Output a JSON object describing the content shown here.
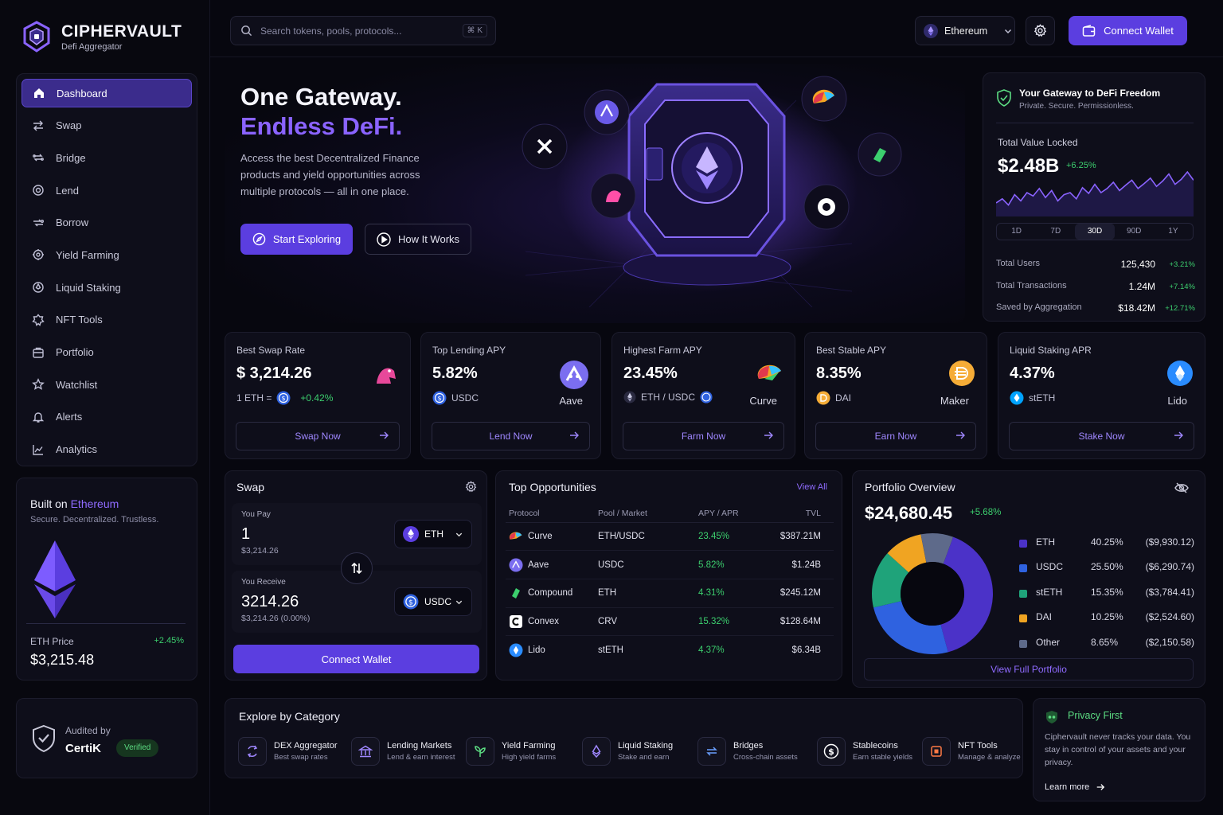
{
  "brand": {
    "name": "CIPHERVAULT",
    "subtitle": "Defi Aggregator"
  },
  "nav": [
    {
      "label": "Dashboard",
      "icon": "home-icon",
      "active": true
    },
    {
      "label": "Swap",
      "icon": "swap-icon"
    },
    {
      "label": "Bridge",
      "icon": "bridge-icon"
    },
    {
      "label": "Lend",
      "icon": "lend-icon"
    },
    {
      "label": "Borrow",
      "icon": "borrow-icon"
    },
    {
      "label": "Yield Farming",
      "icon": "yield-icon"
    },
    {
      "label": "Liquid Staking",
      "icon": "staking-icon"
    },
    {
      "label": "NFT Tools",
      "icon": "nft-icon"
    },
    {
      "label": "Portfolio",
      "icon": "portfolio-icon"
    },
    {
      "label": "Watchlist",
      "icon": "star-icon"
    },
    {
      "label": "Alerts",
      "icon": "bell-icon"
    },
    {
      "label": "Analytics",
      "icon": "chart-icon"
    }
  ],
  "built": {
    "prefix": "Built on ",
    "chain": "Ethereum",
    "tagline": "Secure. Decentralized. Trustless.",
    "price_label": "ETH Price",
    "price_change": "+2.45%",
    "price_value": "$3,215.48"
  },
  "audit": {
    "label": "Audited by",
    "name": "CertiK",
    "badge": "Verified"
  },
  "header": {
    "search_placeholder": "Search tokens, pools, protocols...",
    "search_shortcut": "⌘ K",
    "network": "Ethereum",
    "connect_label": "Connect Wallet"
  },
  "hero": {
    "title_line1": "One Gateway.",
    "title_line2": "Endless DeFi.",
    "description": "Access the best Decentralized Finance products and yield opportunities across multiple protocols — all in one place.",
    "primary_cta": "Start Exploring",
    "secondary_cta": "How It Works"
  },
  "gateway": {
    "title": "Your Gateway to DeFi Freedom",
    "subtitle": "Private. Secure. Permissionless.",
    "tvl_label": "Total Value Locked",
    "tvl_value": "$2.48B",
    "tvl_change": "+6.25%",
    "ranges": [
      "1D",
      "7D",
      "30D",
      "90D",
      "1Y"
    ],
    "active_range": "30D",
    "tvl_series": [
      0.25,
      0.35,
      0.2,
      0.45,
      0.3,
      0.5,
      0.42,
      0.6,
      0.38,
      0.55,
      0.3,
      0.45,
      0.5,
      0.35,
      0.62,
      0.48,
      0.7,
      0.5,
      0.6,
      0.75,
      0.55,
      0.68,
      0.8,
      0.6,
      0.72,
      0.85,
      0.65,
      0.78,
      0.95,
      0.7,
      0.82,
      1.0,
      0.8
    ],
    "stats": [
      {
        "label": "Total Users",
        "value": "125,430",
        "change": "+3.21%"
      },
      {
        "label": "Total Transactions",
        "value": "1.24M",
        "change": "+7.14%"
      },
      {
        "label": "Saved by Aggregation",
        "value": "$18.42M",
        "change": "+12.71%"
      }
    ]
  },
  "metrics": [
    {
      "label": "Best Swap Rate",
      "value": "$ 3,214.26",
      "sub": "1 ETH =",
      "sub_change": "+0.42%",
      "protocol": "",
      "button": "Swap Now",
      "logo": "uniswap-icon"
    },
    {
      "label": "Top Lending APY",
      "value": "5.82%",
      "sub": "USDC",
      "protocol": "Aave",
      "button": "Lend Now",
      "logo": "aave-icon"
    },
    {
      "label": "Highest Farm APY",
      "value": "23.45%",
      "sub": "ETH / USDC",
      "protocol": "Curve",
      "button": "Farm Now",
      "logo": "curve-icon"
    },
    {
      "label": "Best Stable APY",
      "value": "8.35%",
      "sub": "DAI",
      "protocol": "Maker",
      "button": "Earn Now",
      "logo": "maker-icon"
    },
    {
      "label": "Liquid Staking APR",
      "value": "4.37%",
      "sub": "stETH",
      "protocol": "Lido",
      "button": "Stake Now",
      "logo": "lido-icon"
    }
  ],
  "swap": {
    "title": "Swap",
    "pay_label": "You Pay",
    "pay_amount": "1",
    "pay_usd": "$3,214.26",
    "pay_token": "ETH",
    "receive_label": "You Receive",
    "receive_amount": "3214.26",
    "receive_usd": "$3,214.26 (0.00%)",
    "receive_token": "USDC",
    "connect_label": "Connect Wallet"
  },
  "opportunities": {
    "title": "Top Opportunities",
    "view_all": "View All",
    "columns": [
      "Protocol",
      "Pool / Market",
      "APY / APR",
      "TVL"
    ],
    "rows": [
      {
        "protocol": "Curve",
        "pool": "ETH/USDC",
        "apy": "23.45%",
        "tvl": "$387.21M",
        "icon": "curve-icon"
      },
      {
        "protocol": "Aave",
        "pool": "USDC",
        "apy": "5.82%",
        "tvl": "$1.24B",
        "icon": "aave-icon"
      },
      {
        "protocol": "Compound",
        "pool": "ETH",
        "apy": "4.31%",
        "tvl": "$245.12M",
        "icon": "compound-icon"
      },
      {
        "protocol": "Convex",
        "pool": "CRV",
        "apy": "15.32%",
        "tvl": "$128.64M",
        "icon": "convex-icon"
      },
      {
        "protocol": "Lido",
        "pool": "stETH",
        "apy": "4.37%",
        "tvl": "$6.34B",
        "icon": "lido-icon"
      }
    ]
  },
  "portfolio": {
    "title": "Portfolio Overview",
    "value": "$24,680.45",
    "change": "+5.68%",
    "view_full": "View Full Portfolio",
    "assets": [
      {
        "name": "ETH",
        "percent": "40.25%",
        "amount": "($9,930.12)",
        "share": 40.25,
        "color": "#4b32c8"
      },
      {
        "name": "USDC",
        "percent": "25.50%",
        "amount": "($6,290.74)",
        "share": 25.5,
        "color": "#2f62e0"
      },
      {
        "name": "stETH",
        "percent": "15.35%",
        "amount": "($3,784.41)",
        "share": 15.35,
        "color": "#1fa37a"
      },
      {
        "name": "DAI",
        "percent": "10.25%",
        "amount": "($2,524.60)",
        "share": 10.25,
        "color": "#f0a422"
      },
      {
        "name": "Other",
        "percent": "8.65%",
        "amount": "($2,150.58)",
        "share": 8.65,
        "color": "#5e6a8a"
      }
    ]
  },
  "categories": {
    "title": "Explore by Category",
    "items": [
      {
        "name": "DEX Aggregator",
        "desc": "Best swap rates",
        "icon": "dex-icon"
      },
      {
        "name": "Lending Markets",
        "desc": "Lend & earn interest",
        "icon": "bank-icon"
      },
      {
        "name": "Yield Farming",
        "desc": "High yield farms",
        "icon": "sprout-icon"
      },
      {
        "name": "Liquid Staking",
        "desc": "Stake and earn",
        "icon": "eth-icon"
      },
      {
        "name": "Bridges",
        "desc": "Cross-chain assets",
        "icon": "bridge-icon"
      },
      {
        "name": "Stablecoins",
        "desc": "Earn stable yields",
        "icon": "dollar-icon"
      },
      {
        "name": "NFT Tools",
        "desc": "Manage & analyze",
        "icon": "nft-icon"
      }
    ]
  },
  "privacy": {
    "title": "Privacy First",
    "text": "Ciphervault never tracks your data. You stay in control of your assets and your privacy.",
    "link": "Learn more"
  }
}
